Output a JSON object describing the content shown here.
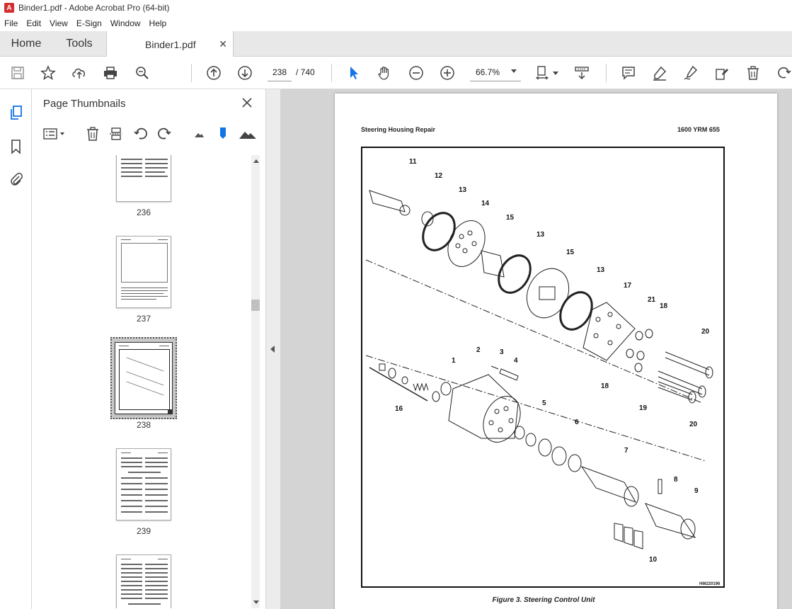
{
  "window": {
    "title": "Binder1.pdf - Adobe Acrobat Pro (64-bit)"
  },
  "menu": [
    "File",
    "Edit",
    "View",
    "E-Sign",
    "Window",
    "Help"
  ],
  "tabs": {
    "home": "Home",
    "tools": "Tools",
    "document": "Binder1.pdf"
  },
  "toolbar": {
    "current_page": "238",
    "total_pages": "/ 740",
    "zoom": "66.7%"
  },
  "panel": {
    "title": "Page Thumbnails",
    "thumbnails": [
      {
        "label": "236"
      },
      {
        "label": "237"
      },
      {
        "label": "238",
        "selected": true
      },
      {
        "label": "239"
      },
      {
        "label": ""
      }
    ]
  },
  "page": {
    "header_left": "Steering Housing Repair",
    "header_right": "1600 YRM 655",
    "figure_caption": "Figure 3. Steering Control Unit",
    "figure_id": "HM220196",
    "callouts": [
      "11",
      "12",
      "13",
      "14",
      "15",
      "13",
      "15",
      "13",
      "17",
      "21",
      "18",
      "20",
      "2",
      "3",
      "4",
      "1",
      "16",
      "5",
      "6",
      "18",
      "19",
      "20",
      "7",
      "8",
      "9",
      "10"
    ]
  },
  "colors": {
    "accent": "#1473e6",
    "tab_bg": "#e8e8e8",
    "viewer_bg": "#d4d4d4"
  }
}
